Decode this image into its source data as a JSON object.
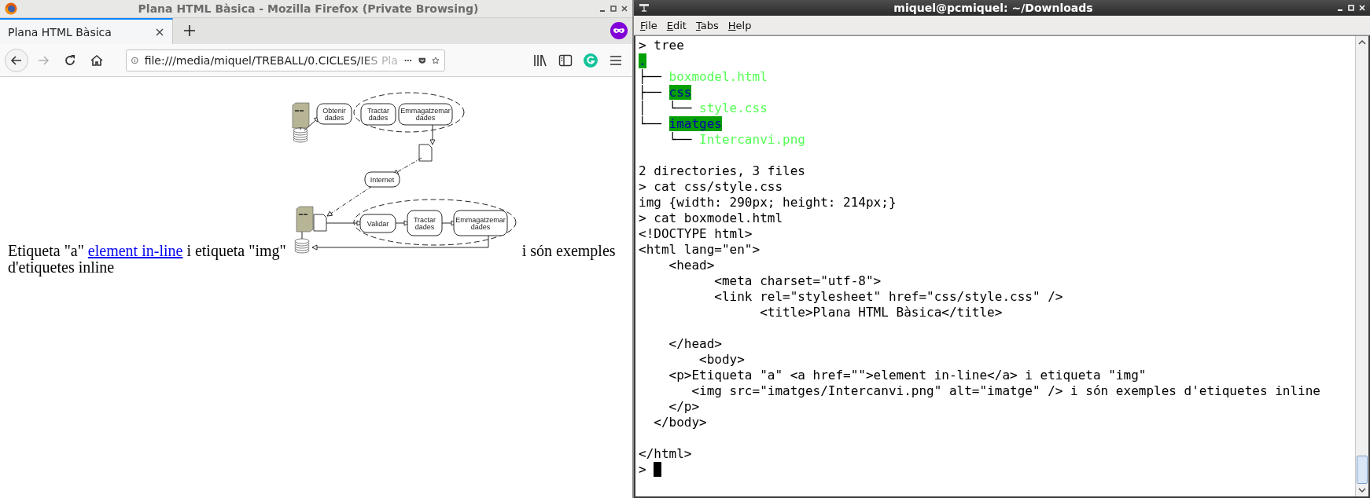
{
  "browser": {
    "window_title": "Plana HTML Bàsica - Mozilla Firefox (Private Browsing)",
    "tabs": [
      {
        "label": "Plana HTML Bàsica",
        "selected": true
      }
    ],
    "nav_buttons": [
      {
        "kind": "back",
        "disabled": false
      },
      {
        "kind": "forward",
        "disabled": true
      },
      {
        "kind": "reload",
        "disabled": false
      },
      {
        "kind": "home",
        "disabled": false
      }
    ],
    "url": "file:///media/miquel/TREBALL/0.CICLES/IES Pla",
    "page": {
      "before": "Etiqueta \"a\" ",
      "link": "element in-line",
      "middle": " i etiqueta \"img\" ",
      "after": " i són exemples d'etiquetes inline",
      "diagram": {
        "nodes": [
          {
            "lines": [
              "Obtenir",
              "dades"
            ]
          },
          {
            "lines": [
              "Tractar",
              "dades"
            ]
          },
          {
            "lines": [
              "Emmagatzemar",
              "dades"
            ]
          },
          {
            "lines": [
              "Internet"
            ]
          },
          {
            "lines": [
              "Validar"
            ]
          },
          {
            "lines": [
              "Tractar",
              "dades"
            ]
          },
          {
            "lines": [
              "Emmagatzemar",
              "dades"
            ]
          }
        ]
      }
    }
  },
  "terminal": {
    "window_title": "miquel@pcmiquel: ~/Downloads",
    "menu": [
      "File",
      "Edit",
      "Tabs",
      "Help"
    ],
    "lines": [
      {
        "kind": "text",
        "segments": [
          {
            "kind": "plain",
            "text": "> tree"
          }
        ]
      },
      {
        "kind": "text",
        "segments": [
          {
            "kind": "dir",
            "text": "."
          }
        ]
      },
      {
        "kind": "text",
        "segments": [
          {
            "kind": "branch",
            "text": "├── "
          },
          {
            "kind": "file",
            "text": "boxmodel.html"
          }
        ]
      },
      {
        "kind": "text",
        "segments": [
          {
            "kind": "branch",
            "text": "├── "
          },
          {
            "kind": "dir",
            "text": "css"
          }
        ]
      },
      {
        "kind": "text",
        "segments": [
          {
            "kind": "branch",
            "text": "│   └── "
          },
          {
            "kind": "file",
            "text": "style.css"
          }
        ]
      },
      {
        "kind": "text",
        "segments": [
          {
            "kind": "branch",
            "text": "└── "
          },
          {
            "kind": "dir",
            "text": "imatges"
          }
        ]
      },
      {
        "kind": "text",
        "segments": [
          {
            "kind": "branch",
            "text": "    └── "
          },
          {
            "kind": "file",
            "text": "Intercanvi.png"
          }
        ]
      },
      {
        "kind": "blank"
      },
      {
        "kind": "text",
        "segments": [
          {
            "kind": "plain",
            "text": "2 directories, 3 files"
          }
        ]
      },
      {
        "kind": "text",
        "segments": [
          {
            "kind": "plain",
            "text": "> cat css/style.css"
          }
        ]
      },
      {
        "kind": "text",
        "segments": [
          {
            "kind": "plain",
            "text": "img {width: 290px; height: 214px;}"
          }
        ]
      },
      {
        "kind": "text",
        "segments": [
          {
            "kind": "plain",
            "text": "> cat boxmodel.html"
          }
        ]
      },
      {
        "kind": "text",
        "segments": [
          {
            "kind": "plain",
            "text": "<!DOCTYPE html>"
          }
        ]
      },
      {
        "kind": "text",
        "segments": [
          {
            "kind": "plain",
            "text": "<html lang=\"en\">"
          }
        ]
      },
      {
        "kind": "text",
        "segments": [
          {
            "kind": "plain",
            "text": "    <head>"
          }
        ]
      },
      {
        "kind": "text",
        "segments": [
          {
            "kind": "plain",
            "text": "          <meta charset=\"utf-8\">"
          }
        ]
      },
      {
        "kind": "text",
        "segments": [
          {
            "kind": "plain",
            "text": "          <link rel=\"stylesheet\" href=\"css/style.css\" />"
          }
        ]
      },
      {
        "kind": "text",
        "segments": [
          {
            "kind": "plain",
            "text": "                <title>Plana HTML Bàsica</title>"
          }
        ]
      },
      {
        "kind": "blank"
      },
      {
        "kind": "text",
        "segments": [
          {
            "kind": "plain",
            "text": "    </head>"
          }
        ]
      },
      {
        "kind": "text",
        "segments": [
          {
            "kind": "plain",
            "text": "        <body>"
          }
        ]
      },
      {
        "kind": "text",
        "segments": [
          {
            "kind": "plain",
            "text": "    <p>Etiqueta \"a\" <a href=\"\">element in-line</a> i etiqueta \"img\""
          }
        ]
      },
      {
        "kind": "text",
        "segments": [
          {
            "kind": "plain",
            "text": "       <img src=\"imatges/Intercanvi.png\" alt=\"imatge\" /> i són exemples d'etiquetes inline"
          }
        ]
      },
      {
        "kind": "text",
        "segments": [
          {
            "kind": "plain",
            "text": "    </p>"
          }
        ]
      },
      {
        "kind": "text",
        "segments": [
          {
            "kind": "plain",
            "text": "  </body>"
          }
        ]
      },
      {
        "kind": "blank"
      },
      {
        "kind": "text",
        "segments": [
          {
            "kind": "plain",
            "text": "</html>"
          }
        ]
      }
    ],
    "prompt": {
      "text": ">",
      "cursor": true
    }
  }
}
